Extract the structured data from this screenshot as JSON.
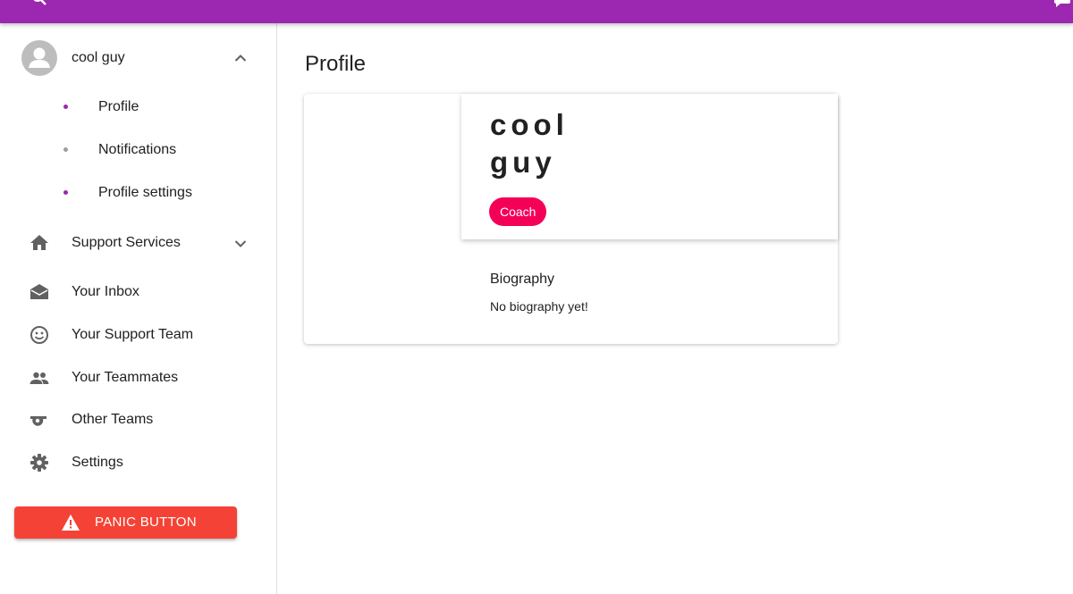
{
  "app": {
    "title": "",
    "accent_color": "#9c27b0",
    "left_icon": "search-icon",
    "right_icon": "chat-icon"
  },
  "sidebar": {
    "user": {
      "name": "cool guy",
      "avatar_icon": "account-circle-icon",
      "toggle_icon": "chevron-up-icon"
    },
    "profile_subitems": [
      {
        "label": "Profile",
        "active": true
      },
      {
        "label": "Notifications",
        "active": false
      },
      {
        "label": "Profile settings",
        "active": true
      }
    ],
    "nav": [
      {
        "label": "Support Services",
        "icon": "home-icon",
        "expandable": true
      },
      {
        "label": "Your Inbox",
        "icon": "inbox-icon"
      },
      {
        "label": "Your Support Team",
        "icon": "smiley-icon"
      },
      {
        "label": "Your Teammates",
        "icon": "people-icon"
      },
      {
        "label": "Other Teams",
        "icon": "whistle-icon"
      },
      {
        "label": "Settings",
        "icon": "gear-icon"
      }
    ],
    "panic_button": {
      "label": "PANIC BUTTON",
      "icon": "warning-icon",
      "color": "#f44336"
    }
  },
  "main": {
    "page_title": "Profile",
    "profile_card": {
      "name_line1": "cool",
      "name_line2": "guy",
      "role_badge": "Coach",
      "badge_color": "#f50057",
      "bio_heading": "Biography",
      "bio_text": "No biography yet!"
    }
  }
}
